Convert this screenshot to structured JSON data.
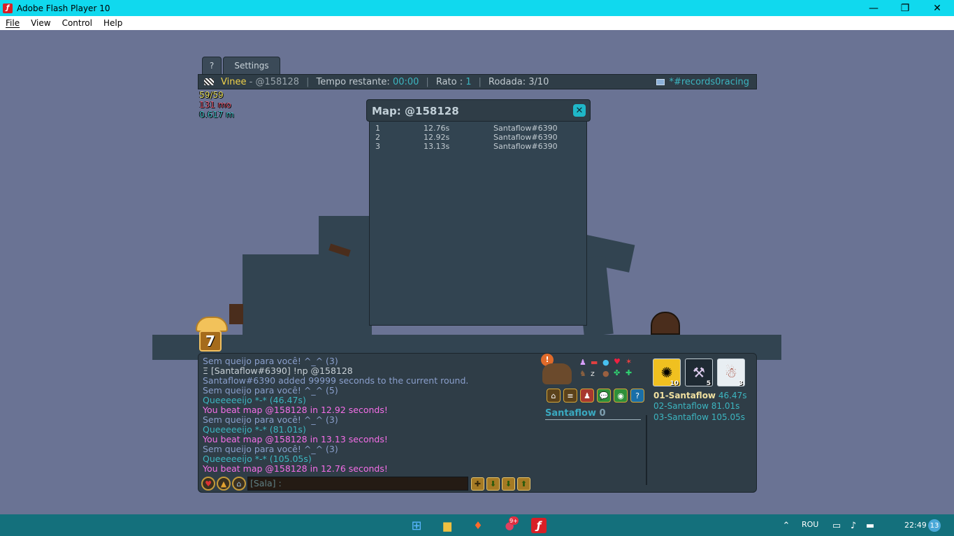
{
  "window": {
    "title": "Adobe Flash Player 10",
    "minimize": "—",
    "restore": "❐",
    "close": "✕"
  },
  "menu": [
    "File",
    "View",
    "Control",
    "Help"
  ],
  "tabs": {
    "help": "?",
    "settings": "Settings"
  },
  "topbar": {
    "player": "Vinee",
    "map_prefix": " - ",
    "map": "@158128",
    "time_label": "Tempo restante: ",
    "time_value": "00:00",
    "mice_label": "Rato : ",
    "mice_value": "1",
    "round": "Rodada: 3/10",
    "room": "*#records0racing"
  },
  "stats": {
    "fps": "59",
    "fps_max": "/59",
    "memory": "131 mo",
    "distance": "0.617 m"
  },
  "map_window": {
    "title": "Map: @158128",
    "close": "✕",
    "records": [
      {
        "rank": "1",
        "time": "12.76s",
        "player": "Santaflow#6390"
      },
      {
        "rank": "2",
        "time": "12.92s",
        "player": "Santaflow#6390"
      },
      {
        "rank": "3",
        "time": "13.13s",
        "player": "Santaflow#6390"
      }
    ]
  },
  "game": {
    "badge": "7"
  },
  "chat": {
    "lines": [
      {
        "text": "Sem queijo para você! ^_^ (3)",
        "style": "c-grey"
      },
      {
        "text": "Ξ [Santaflow#6390] !np @158128",
        "style": "c-white"
      },
      {
        "text": "Santaflow#6390 added 99999 seconds to the current round.",
        "style": "c-grey"
      },
      {
        "text": "Sem queijo para você! ^_^ (5)",
        "style": "c-grey"
      },
      {
        "text": "Queeeeeijo *-* (46.47s)",
        "style": "c-teal"
      },
      {
        "text": "You beat map @158128 in 12.92 seconds!",
        "style": "c-pink"
      },
      {
        "text": "Sem queijo para você! ^_^ (3)",
        "style": "c-grey"
      },
      {
        "text": "Queeeeeijo *-* (81.01s)",
        "style": "c-teal"
      },
      {
        "text": "You beat map @158128 in 13.13 seconds!",
        "style": "c-pink"
      },
      {
        "text": "Sem queijo para você! ^_^ (3)",
        "style": "c-grey"
      },
      {
        "text": "Queeeeeijo *-* (105.05s)",
        "style": "c-teal"
      },
      {
        "text": "You beat map @158128 in 12.76 seconds!",
        "style": "c-pink"
      }
    ],
    "input_placeholder": "[Sala] :"
  },
  "player": {
    "name": "Santaflow",
    "score": "0"
  },
  "powers": [
    {
      "name": "sparkle-power-icon",
      "count": "10"
    },
    {
      "name": "axe-power-icon",
      "count": "5"
    },
    {
      "name": "snowman-power-icon",
      "count": "3"
    }
  ],
  "ranking": [
    {
      "label": "01-Santaflow",
      "time": "46.47s"
    },
    {
      "label": "02-Santaflow",
      "time": "81.01s"
    },
    {
      "label": "03-Santaflow",
      "time": "105.05s"
    }
  ],
  "taskbar": {
    "badge_count": "9+",
    "lang": "ROU",
    "time": "22:49",
    "notif": "13"
  },
  "colors": {
    "background": "#6a7394",
    "panel": "#2f3d47",
    "accent": "#10d9ee",
    "taskbar": "#14707c"
  }
}
